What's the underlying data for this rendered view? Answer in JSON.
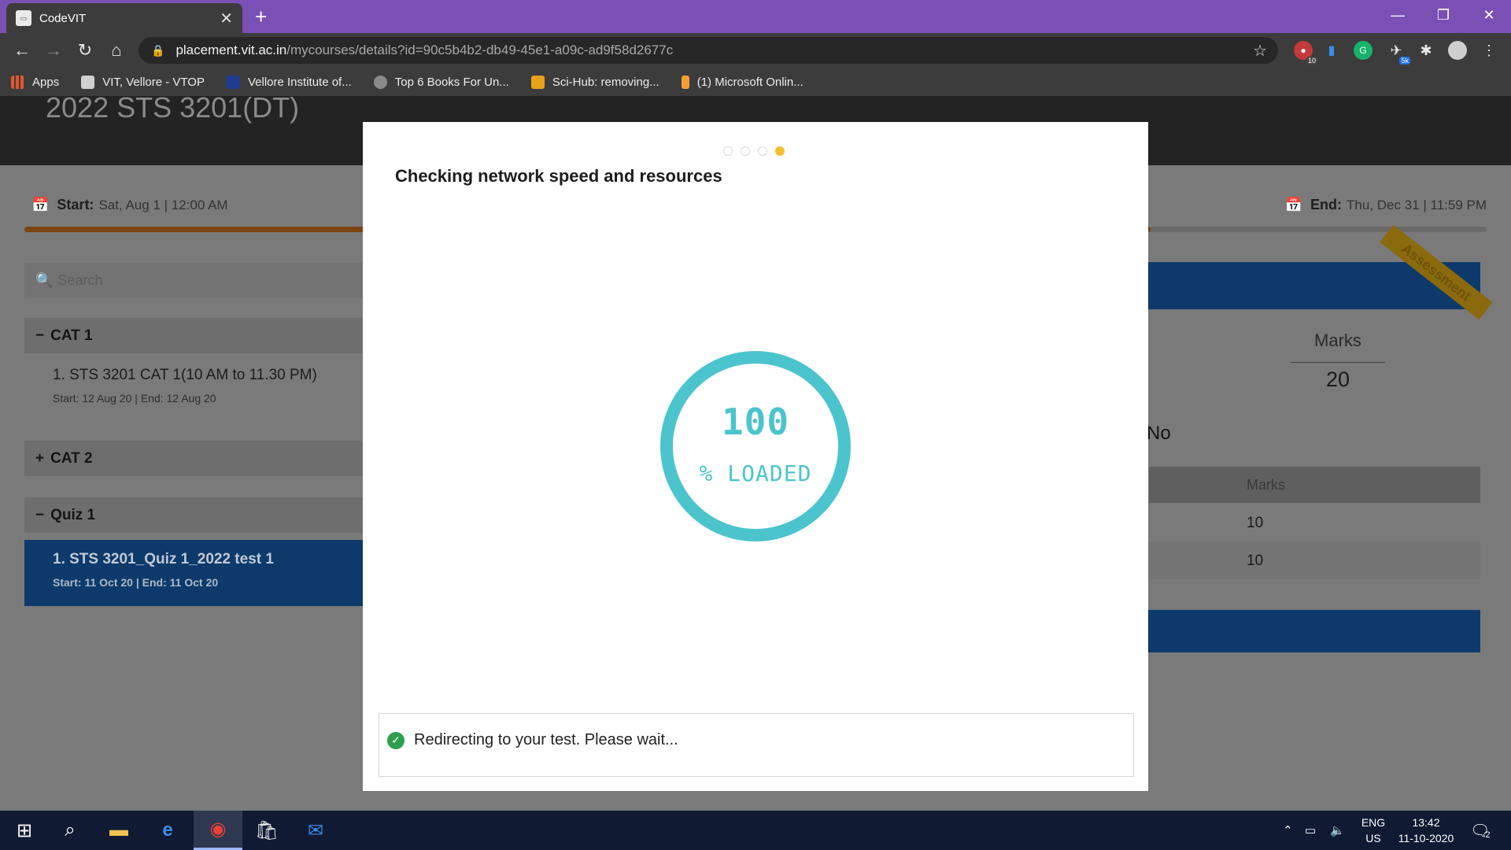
{
  "browser": {
    "tab_title": "CodeVIT",
    "tab_close": "✕",
    "new_tab": "+",
    "url_host": "placement.vit.ac.in",
    "url_path": "/mycourses/details?id=90c5b4b2-db49-45e1-a09c-ad9f58d2677c",
    "window_controls": {
      "minimize": "—",
      "restore": "❐",
      "close": "✕"
    },
    "extension_badges": {
      "ext1": "10",
      "ext4": "5k"
    }
  },
  "bookmarks": [
    {
      "label": "Apps",
      "icon": "apps-grid-icon",
      "color": "#e4572e"
    },
    {
      "label": "VIT, Vellore - VTOP",
      "icon": "vtop-icon",
      "color": "#d0d0d0"
    },
    {
      "label": "Vellore Institute of...",
      "icon": "vit-icon",
      "color": "#1d3c8f"
    },
    {
      "label": "Top 6 Books For Un...",
      "icon": "books-icon",
      "color": "#8a8a8a"
    },
    {
      "label": "Sci-Hub: removing...",
      "icon": "scihub-icon",
      "color": "#e8a21a"
    },
    {
      "label": "(1) Microsoft Onlin...",
      "icon": "microsoft-icon",
      "color": "#f0a030"
    }
  ],
  "course": {
    "title": "2022 STS 3201(DT)",
    "start_label": "Start:",
    "start_value": "Sat, Aug 1 | 12:00 AM",
    "end_label": "End:",
    "end_value": "Thu, Dec 31 | 11:59 PM",
    "progress_fraction": 0.77
  },
  "sidebar": {
    "search_placeholder": "Search",
    "sections": [
      {
        "sign": "−",
        "label": "CAT 1"
      },
      {
        "sign": "+",
        "label": "CAT 2"
      },
      {
        "sign": "−",
        "label": "Quiz 1"
      }
    ],
    "items": [
      {
        "title": "1. STS 3201 CAT 1(10 AM to 11.30 PM)",
        "meta": "Start: 12 Aug 20 | End: 12 Aug 20"
      },
      {
        "title": "1. STS 3201_Quiz 1_2022 test 1",
        "meta": "Start: 11 Oct 20 | End: 11 Oct 20"
      }
    ]
  },
  "detail": {
    "ribbon": "Assessment",
    "marks_label": "Marks",
    "marks_value": "20",
    "no_text": "No",
    "table_header": "Marks",
    "rows": [
      "10",
      "10"
    ]
  },
  "modal": {
    "step_count": 4,
    "active_step": 4,
    "title": "Checking network speed and resources",
    "percent": "100",
    "loaded_label": "% LOADED",
    "status": "Redirecting to your test. Please wait..."
  },
  "taskbar": {
    "lang": "ENG",
    "region": "US",
    "time": "13:42",
    "date": "11-10-2020",
    "notifications": "2"
  }
}
